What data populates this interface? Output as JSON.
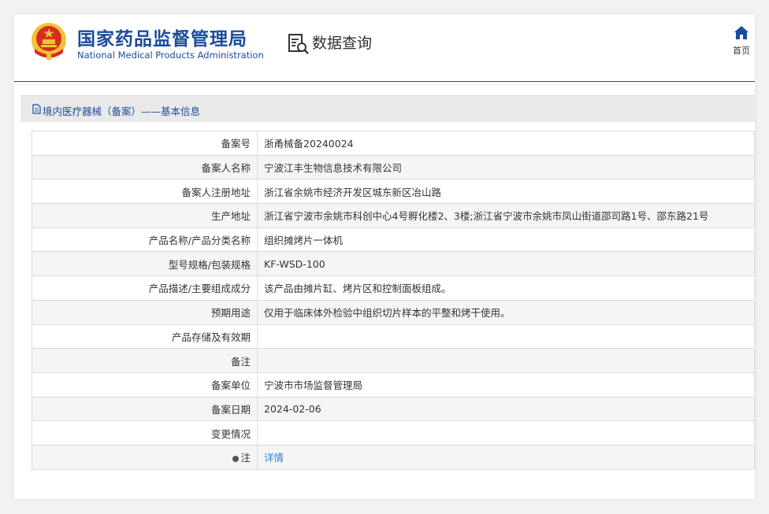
{
  "header": {
    "brand_cn": "国家药品监督管理局",
    "brand_en": "National Medical Products Administration",
    "query_title": "数据查询",
    "home_label": "首页"
  },
  "section": {
    "title": "境内医疗器械（备案）——基本信息"
  },
  "records": [
    {
      "label": "备案号",
      "value": "浙甬械备20240024"
    },
    {
      "label": "备案人名称",
      "value": "宁波江丰生物信息技术有限公司"
    },
    {
      "label": "备案人注册地址",
      "value": "浙江省余姚市经济开发区城东新区冶山路"
    },
    {
      "label": "生产地址",
      "value": "浙江省宁波市余姚市科创中心4号孵化楼2、3楼;浙江省宁波市余姚市凤山街道邵司路1号、邵东路21号"
    },
    {
      "label": "产品名称/产品分类名称",
      "value": "组织摊烤片一体机"
    },
    {
      "label": "型号规格/包装规格",
      "value": "KF-WSD-100"
    },
    {
      "label": "产品描述/主要组成成分",
      "value": "该产品由摊片缸、烤片区和控制面板组成。"
    },
    {
      "label": "预期用途",
      "value": "仅用于临床体外检验中组织切片样本的平整和烤干使用。"
    },
    {
      "label": "产品存储及有效期",
      "value": ""
    },
    {
      "label": "备注",
      "value": ""
    },
    {
      "label": "备案单位",
      "value": "宁波市市场监督管理局"
    },
    {
      "label": "备案日期",
      "value": "2024-02-06"
    },
    {
      "label": "变更情况",
      "value": ""
    }
  ],
  "note_row": {
    "label": "注",
    "link": "详情"
  },
  "colors": {
    "brand_blue": "#1b4b9c",
    "link_blue": "#2f7fd6",
    "emblem_red": "#d92b20",
    "emblem_gold": "#f2c23a"
  },
  "icons": {
    "emblem": "national-emblem-icon",
    "query": "data-query-icon",
    "home": "home-icon",
    "section": "document-icon",
    "note": "note-dot-icon"
  }
}
